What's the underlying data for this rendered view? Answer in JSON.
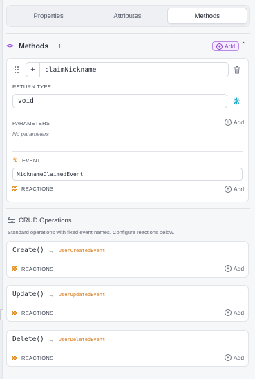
{
  "tabs": [
    {
      "label": "Properties",
      "active": false
    },
    {
      "label": "Attributes",
      "active": false
    },
    {
      "label": "Methods",
      "active": true
    }
  ],
  "methods": {
    "title": "Methods",
    "count": "1",
    "add_label": "Add",
    "item": {
      "plus": "+",
      "name": "claimNickname",
      "return_type_label": "RETURN TYPE",
      "return_type": "void",
      "parameters_label": "PARAMETERS",
      "parameters_add": "Add",
      "no_parameters": "No parameters",
      "event_label": "EVENT",
      "event_name": "NicknameClaimedEvent",
      "reactions_label": "REACTIONS",
      "reactions_add": "Add"
    }
  },
  "crud": {
    "title": "CRUD Operations",
    "description": "Standard operations with fixed event names. Configure reactions below.",
    "arrow": "→",
    "operations": [
      {
        "name": "Create()",
        "event": "UserCreatedEvent",
        "reactions_label": "REACTIONS",
        "add": "Add"
      },
      {
        "name": "Update()",
        "event": "UserUpdatedEvent",
        "reactions_label": "REACTIONS",
        "add": "Add"
      },
      {
        "name": "Delete()",
        "event": "UserDeletedEvent",
        "reactions_label": "REACTIONS",
        "add": "Add"
      }
    ]
  },
  "icons": {
    "code": "code-icon",
    "drag": "drag-handle-icon",
    "trash": "trash-icon",
    "snowflake": "snowflake-icon",
    "bolt": "bolt-icon",
    "reactions": "reactions-grid-icon",
    "sliders": "sliders-icon",
    "chevron": "chevron-up-icon"
  },
  "colors": {
    "accent_purple": "#8b3fd1",
    "event_orange": "#d67a1a",
    "snowflake_cyan": "#1aa7c8"
  }
}
